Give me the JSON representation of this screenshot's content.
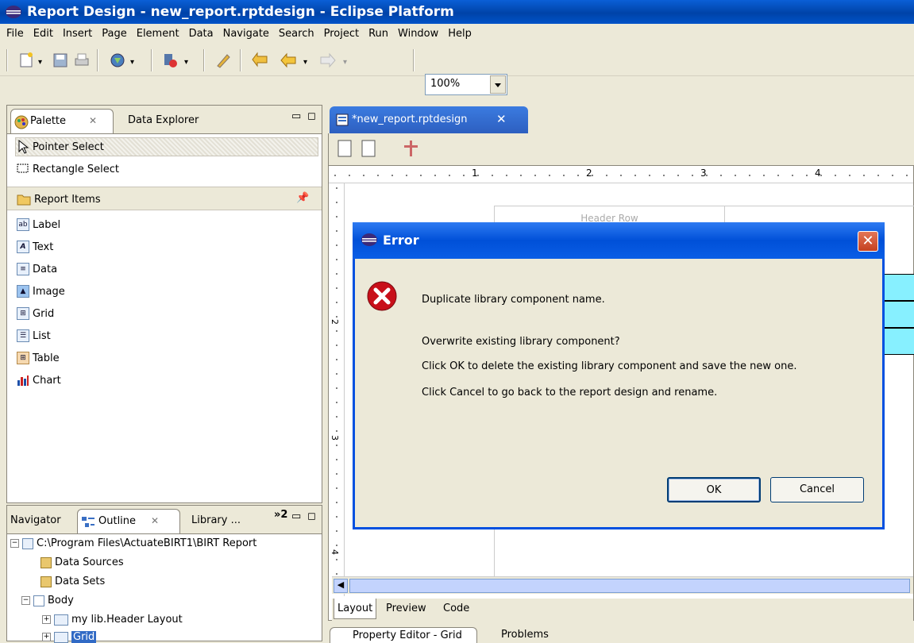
{
  "window": {
    "title": "Report Design - new_report.rptdesign - Eclipse Platform"
  },
  "menu": [
    "File",
    "Edit",
    "Insert",
    "Page",
    "Element",
    "Data",
    "Navigate",
    "Search",
    "Project",
    "Run",
    "Window",
    "Help"
  ],
  "toolbar": {
    "zoom": "100%"
  },
  "palette_panel": {
    "tabs": [
      "Palette",
      "Data Explorer"
    ],
    "tools": [
      "Pointer Select",
      "Rectangle Select"
    ],
    "group": "Report Items",
    "items": [
      "Label",
      "Text",
      "Data",
      "Image",
      "Grid",
      "List",
      "Table",
      "Chart"
    ]
  },
  "outline_panel": {
    "tabs": [
      "Navigator",
      "Outline",
      "Library ..."
    ],
    "overflow": "»2",
    "tree": [
      "C:\\Program Files\\ActuateBIRT1\\BIRT Report",
      "Data Sources",
      "Data Sets",
      "Body",
      "my lib.Header Layout",
      "Grid"
    ]
  },
  "editor": {
    "tab": "*new_report.rptdesign",
    "ruler_numbers": [
      "1",
      "2",
      "3",
      "4"
    ],
    "vruler_numbers": [
      "2",
      "3",
      "4"
    ],
    "header_row_text": "Header Row",
    "bottom_tabs": [
      "Layout",
      "Preview",
      "Code"
    ]
  },
  "bottom_panel": {
    "tabs": [
      "Property Editor - Grid",
      "Problems"
    ]
  },
  "dialog": {
    "title": "Error",
    "lines": [
      "Duplicate library component name.",
      "Overwrite existing library component?",
      "Click OK to delete the existing library component and save the new one.",
      "Click Cancel to go back to the report design and rename."
    ],
    "ok": "OK",
    "cancel": "Cancel"
  },
  "colors": {
    "accent": "#0050e0",
    "error": "#c8101a",
    "grid_cell": "#87f0ff"
  }
}
